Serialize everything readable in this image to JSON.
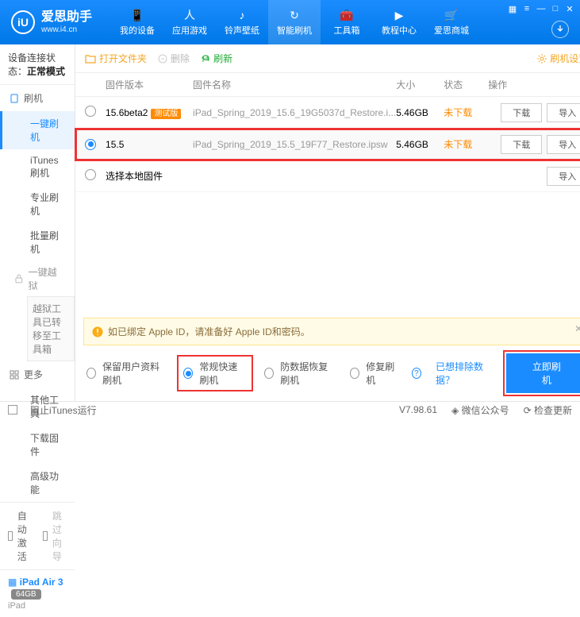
{
  "brand": {
    "name": "爱思助手",
    "url": "www.i4.cn",
    "logo_letter": "iU"
  },
  "nav": [
    {
      "label": "我的设备",
      "icon": "📱"
    },
    {
      "label": "应用游戏",
      "icon": "人"
    },
    {
      "label": "铃声壁纸",
      "icon": "♪"
    },
    {
      "label": "智能刷机",
      "icon": "↻",
      "active": true
    },
    {
      "label": "工具箱",
      "icon": "🧰"
    },
    {
      "label": "教程中心",
      "icon": "▶"
    },
    {
      "label": "爱思商城",
      "icon": "🛒"
    }
  ],
  "status": {
    "label": "设备连接状态：",
    "value": "正常模式"
  },
  "side": {
    "cat_flash": "刷机",
    "items_flash": [
      "一键刷机",
      "iTunes刷机",
      "专业刷机",
      "批量刷机"
    ],
    "cat_jail": "一键越狱",
    "jail_box": "越狱工具已转移至工具箱",
    "cat_more": "更多",
    "items_more": [
      "其他工具",
      "下载固件",
      "高级功能"
    ],
    "auto_activate": "自动激活",
    "skip_guide": "跳过向导",
    "device": {
      "name": "iPad Air 3",
      "badge": "64GB",
      "sub": "iPad"
    }
  },
  "toolbar": {
    "open": "打开文件夹",
    "delete": "删除",
    "refresh": "刷新",
    "settings": "刷机设置"
  },
  "thead": {
    "ver": "固件版本",
    "name": "固件名称",
    "size": "大小",
    "status": "状态",
    "op": "操作"
  },
  "rows": [
    {
      "selected": false,
      "ver": "15.6beta2",
      "tag": "测试版",
      "name": "iPad_Spring_2019_15.6_19G5037d_Restore.i...",
      "size": "5.46GB",
      "status": "未下载"
    },
    {
      "selected": true,
      "ver": "15.5",
      "tag": "",
      "name": "iPad_Spring_2019_15.5_19F77_Restore.ipsw",
      "size": "5.46GB",
      "status": "未下载"
    }
  ],
  "local_row": "选择本地固件",
  "btns": {
    "download": "下载",
    "import": "导入"
  },
  "notice": "如已绑定 Apple ID，请准备好 Apple ID和密码。",
  "modes": {
    "keep": "保留用户资料刷机",
    "normal": "常规快速刷机",
    "anti": "防数据恢复刷机",
    "repair": "修复刷机",
    "exclude": "已想排除数据？",
    "go": "立即刷机"
  },
  "footer": {
    "block_itunes": "阻止iTunes运行",
    "version": "V7.98.61",
    "wechat": "微信公众号",
    "update": "检查更新"
  }
}
